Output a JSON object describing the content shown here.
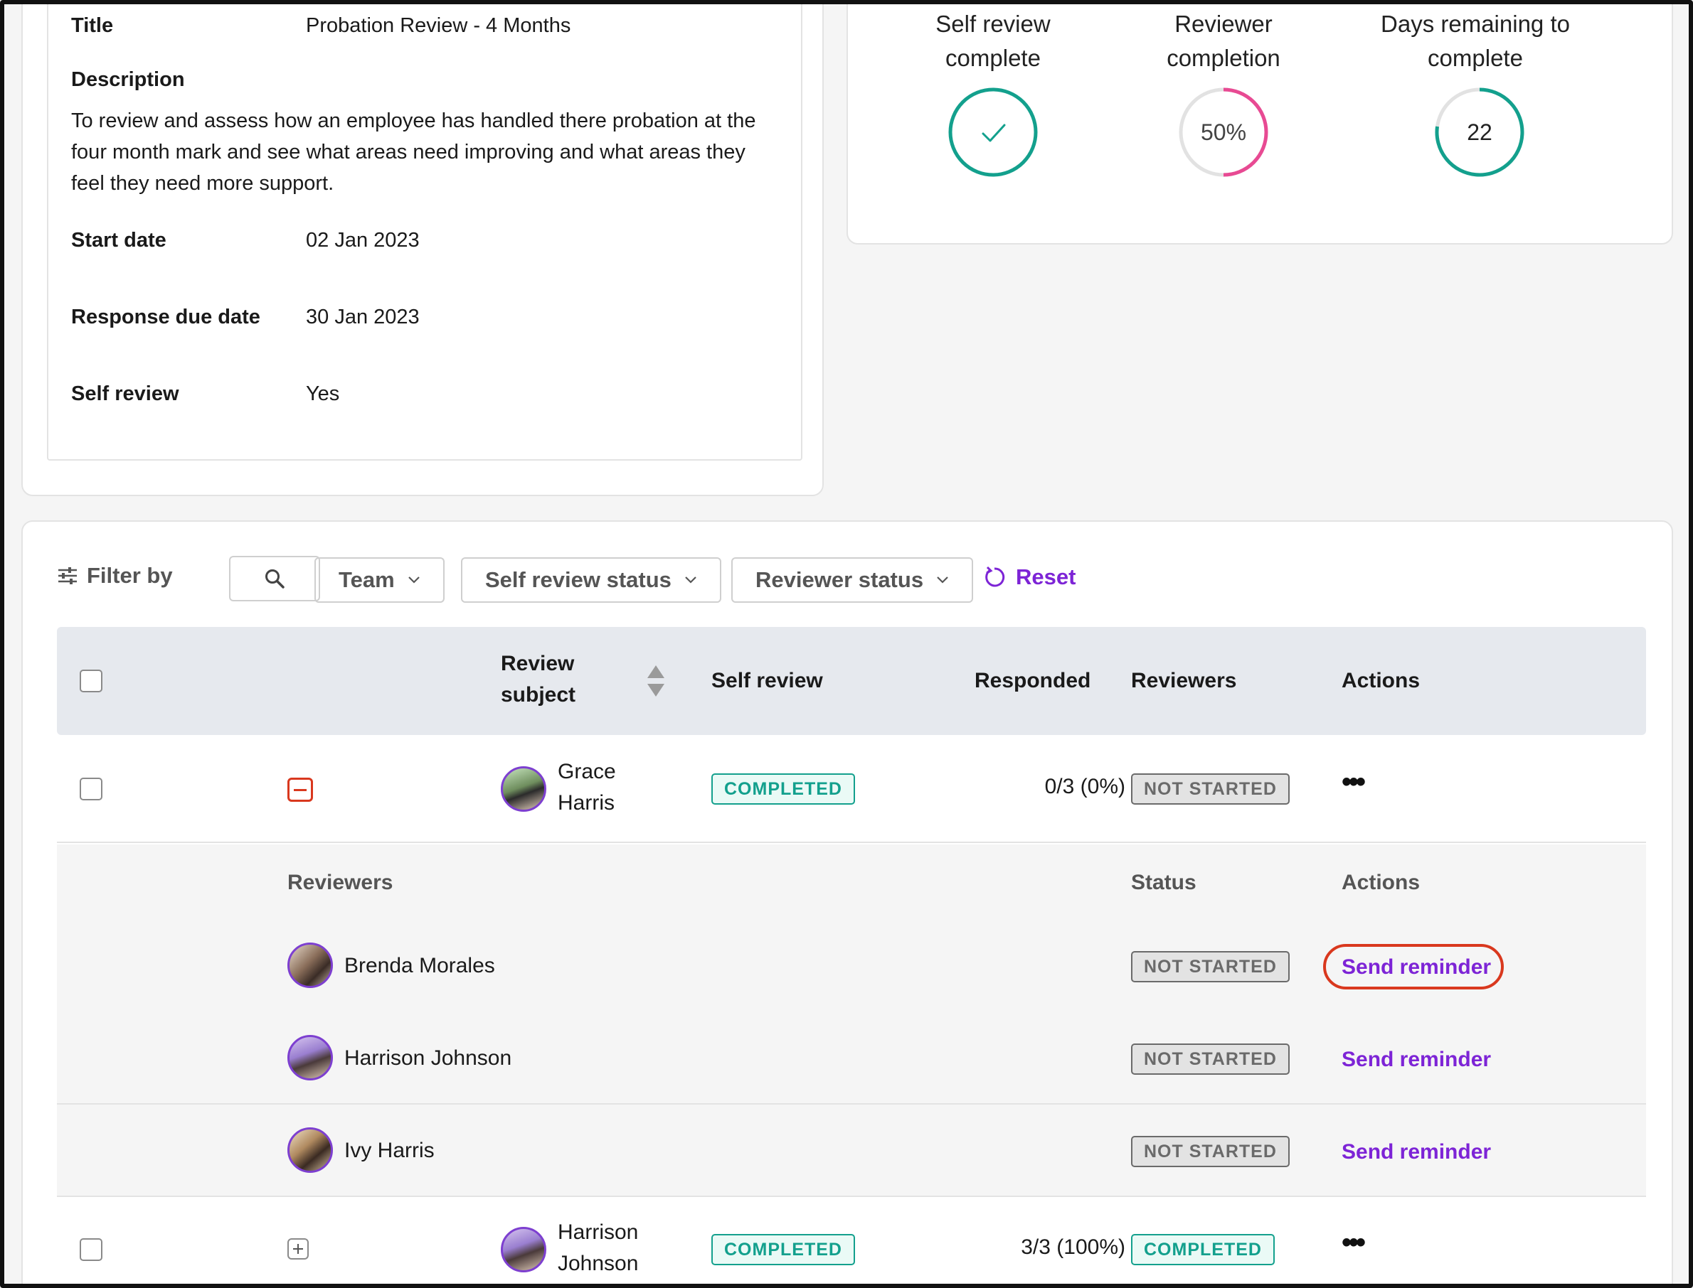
{
  "details": {
    "title_label": "Title",
    "title_value": "Probation Review - 4 Months",
    "description_label": "Description",
    "description_value": "To review and assess how an employee has handled there probation at the four month mark and see what areas need improving and what areas they feel they need more support.",
    "start_label": "Start date",
    "start_value": "02 Jan 2023",
    "due_label": "Response due date",
    "due_value": "30 Jan 2023",
    "self_label": "Self review",
    "self_value": "Yes"
  },
  "stats": {
    "self_review": {
      "label_line1": "Self review",
      "label_line2": "complete",
      "progress": 1.0
    },
    "reviewer": {
      "label_line1": "Reviewer",
      "label_line2": "completion",
      "value": "50%",
      "progress": 0.5
    },
    "days": {
      "label_line1": "Days remaining to",
      "label_line2": "complete",
      "value": "22",
      "progress": 0.78
    }
  },
  "colors": {
    "accent": "#7d24d6",
    "teal": "#13a08d",
    "pink": "#e84a93",
    "danger_outline": "#d9381e"
  },
  "filters": {
    "label": "Filter by",
    "team": "Team",
    "self_status": "Self review status",
    "reviewer_status": "Reviewer status",
    "reset": "Reset"
  },
  "table": {
    "headers": {
      "subject_line1": "Review",
      "subject_line2": "subject",
      "self_review": "Self review",
      "responded": "Responded",
      "reviewers": "Reviewers",
      "actions": "Actions"
    },
    "rows": [
      {
        "name_line1": "Grace",
        "name_line2": "Harris",
        "self_review": "COMPLETED",
        "responded": "0/3 (0%)",
        "reviewers": "NOT STARTED",
        "actions": "•••"
      },
      {
        "name_line1": "Harrison",
        "name_line2": "Johnson",
        "self_review": "COMPLETED",
        "responded": "3/3 (100%)",
        "reviewers": "COMPLETED",
        "actions": "•••"
      }
    ],
    "sub_headers": {
      "reviewers": "Reviewers",
      "status": "Status",
      "actions": "Actions"
    },
    "sub_rows": [
      {
        "name": "Brenda Morales",
        "status": "NOT STARTED",
        "action": "Send reminder"
      },
      {
        "name": "Harrison Johnson",
        "status": "NOT STARTED",
        "action": "Send reminder"
      },
      {
        "name": "Ivy Harris",
        "status": "NOT STARTED",
        "action": "Send reminder"
      }
    ]
  }
}
